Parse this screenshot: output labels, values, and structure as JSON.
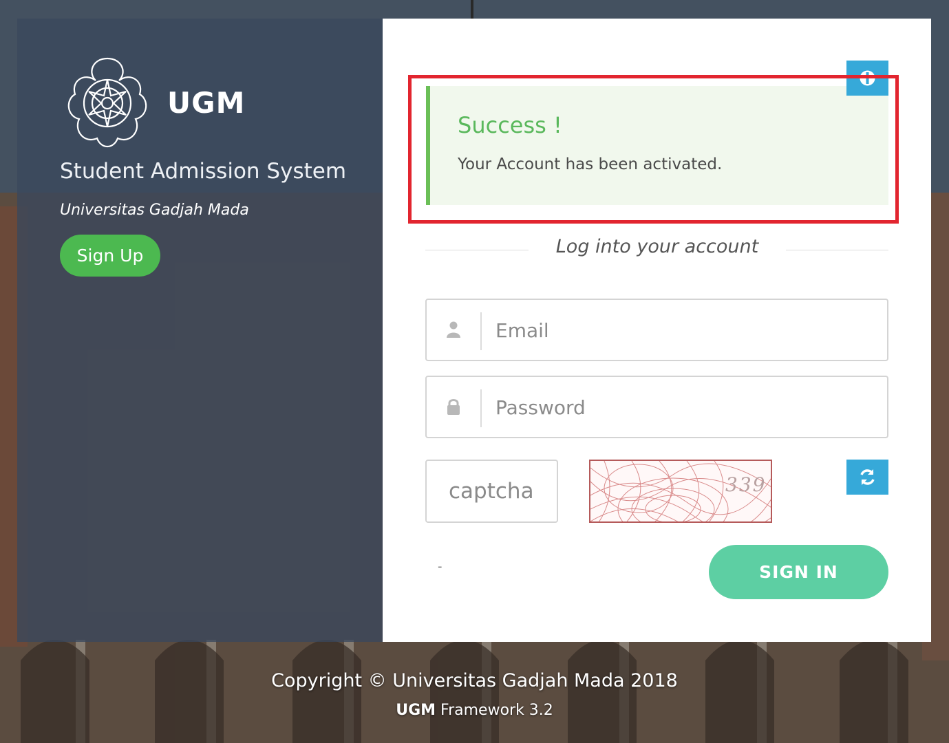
{
  "brand": {
    "name": "UGM",
    "system_title": "Student Admission System",
    "university": "Universitas Gadjah Mada",
    "signup_label": "Sign Up",
    "logo_icon": "ugm-seal-icon"
  },
  "alert": {
    "title": "Success !",
    "message": "Your Account has been activated.",
    "close_icon": "close-circle-icon",
    "accent_color": "#6bbf57"
  },
  "login": {
    "heading": "Log into your account",
    "email_placeholder": "Email",
    "email_icon": "user-icon",
    "password_placeholder": "Password",
    "password_icon": "lock-icon",
    "captcha_placeholder": "captcha",
    "captcha_code": "339",
    "refresh_icon": "refresh-icon",
    "dash": "-",
    "signin_label": "SIGN IN"
  },
  "footer": {
    "copyright": "Copyright © Universitas Gadjah Mada 2018",
    "framework_brand": "UGM",
    "framework_text": "Framework 3.2"
  },
  "colors": {
    "signup_green": "#4cb950",
    "signin_teal": "#5dcfa3",
    "action_blue": "#36a9d9",
    "highlight_red": "#e2252f"
  }
}
